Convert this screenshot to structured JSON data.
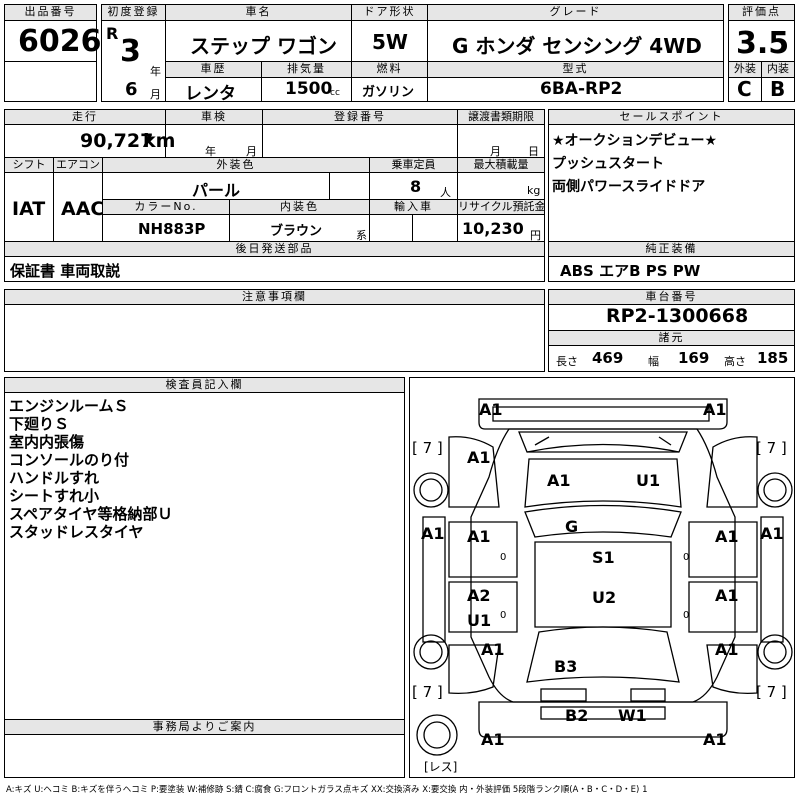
{
  "header": {
    "lot_label": "出品番号",
    "lot_no": "6026",
    "first_reg_label": "初度登録",
    "era": "R",
    "year": "3",
    "year_unit": "年",
    "month": "6",
    "month_unit": "月",
    "car_name_label": "車名",
    "car_name": "ステップ ワゴン",
    "door_label": "ドア形状",
    "door": "5W",
    "grade_label": "グレード",
    "grade": "G ホンダ センシング 4WD",
    "score_label": "評価点",
    "score": "3.5",
    "history_label": "車歴",
    "history": "レンタ",
    "displacement_label": "排気量",
    "displacement": "1500",
    "displacement_unit": "cc",
    "fuel_label": "燃料",
    "fuel": "ガソリン",
    "model_label": "型式",
    "model": "6BA-RP2",
    "ext_label": "外装",
    "ext_grade": "C",
    "int_label": "内装",
    "int_grade": "B"
  },
  "row2": {
    "mileage_label": "走行",
    "mileage": "90,727",
    "mileage_unit": "km",
    "inspection_label": "車検",
    "insp_year": "年",
    "insp_month": "月",
    "plate_label": "登録番号",
    "transfer_label": "譲渡書類期限",
    "tr_month": "月",
    "tr_day": "日",
    "shift_label": "シフト",
    "shift": "IAT",
    "ac_label": "エアコン",
    "ac": "AAC",
    "color_label": "外装色",
    "color": "パール",
    "seats_label": "乗車定員",
    "seats": "8",
    "seats_unit": "人",
    "load_label": "最大積載量",
    "load_unit": "kg",
    "color_no_label": "カラーNo.",
    "color_no": "NH883P",
    "interior_label": "内装色",
    "interior": "ブラウン",
    "interior_unit": "系",
    "import_label": "輸入車",
    "recycle_label": "リサイクル預託金",
    "recycle": "10,230",
    "recycle_unit": "円",
    "later_label": "後日発送部品",
    "later": "保証書 車両取説"
  },
  "sales": {
    "label": "セールスポイント",
    "lines": [
      "★オークションデビュー★",
      "プッシュスタート",
      "両側パワースライドドア"
    ]
  },
  "equip": {
    "label": "純正装備",
    "value": "ABS エアB PS PW"
  },
  "notes": {
    "label": "注意事項欄"
  },
  "chassis": {
    "label": "車台番号",
    "value": "RP2-1300668"
  },
  "specs": {
    "label": "諸元",
    "len_label": "長さ",
    "len": "469",
    "wid_label": "幅",
    "wid": "169",
    "hgt_label": "高さ",
    "hgt": "185"
  },
  "inspector": {
    "label": "検査員記入欄",
    "lines": [
      "エンジンルームＳ",
      "下廻りＳ",
      "室内内張傷",
      "コンソールのり付",
      "ハンドルすれ",
      "シートすれ小",
      "スペアタイヤ等格納部Ｕ",
      "スタッドレスタイヤ"
    ]
  },
  "office": {
    "label": "事務局よりご案内"
  },
  "diagram": {
    "marks": [
      "A1",
      "A1",
      "A1",
      "A1",
      "U1",
      "A1",
      "G",
      "A1",
      "A1",
      "A1",
      "S1",
      "A1",
      "A2",
      "U2",
      "A1",
      "U1",
      "A1",
      "B3",
      "B2",
      "W1",
      "A1",
      "A1"
    ],
    "tires": [
      "[ 7 ]",
      "[ 7 ]",
      "[ 7 ]",
      "[ 7 ]"
    ],
    "spare": "[レス]",
    "zeros": [
      "0",
      "0",
      "0",
      "0"
    ]
  },
  "legend": "A:キズ U:ヘコミ B:キズを伴うヘコミ P:要塗装 W:補修跡 S:錆 C:腐食 G:フロントガラス点キズ XX:交換済み X:要交換 内・外装評価 5段階ランク順(A・B・C・D・E) 1"
}
